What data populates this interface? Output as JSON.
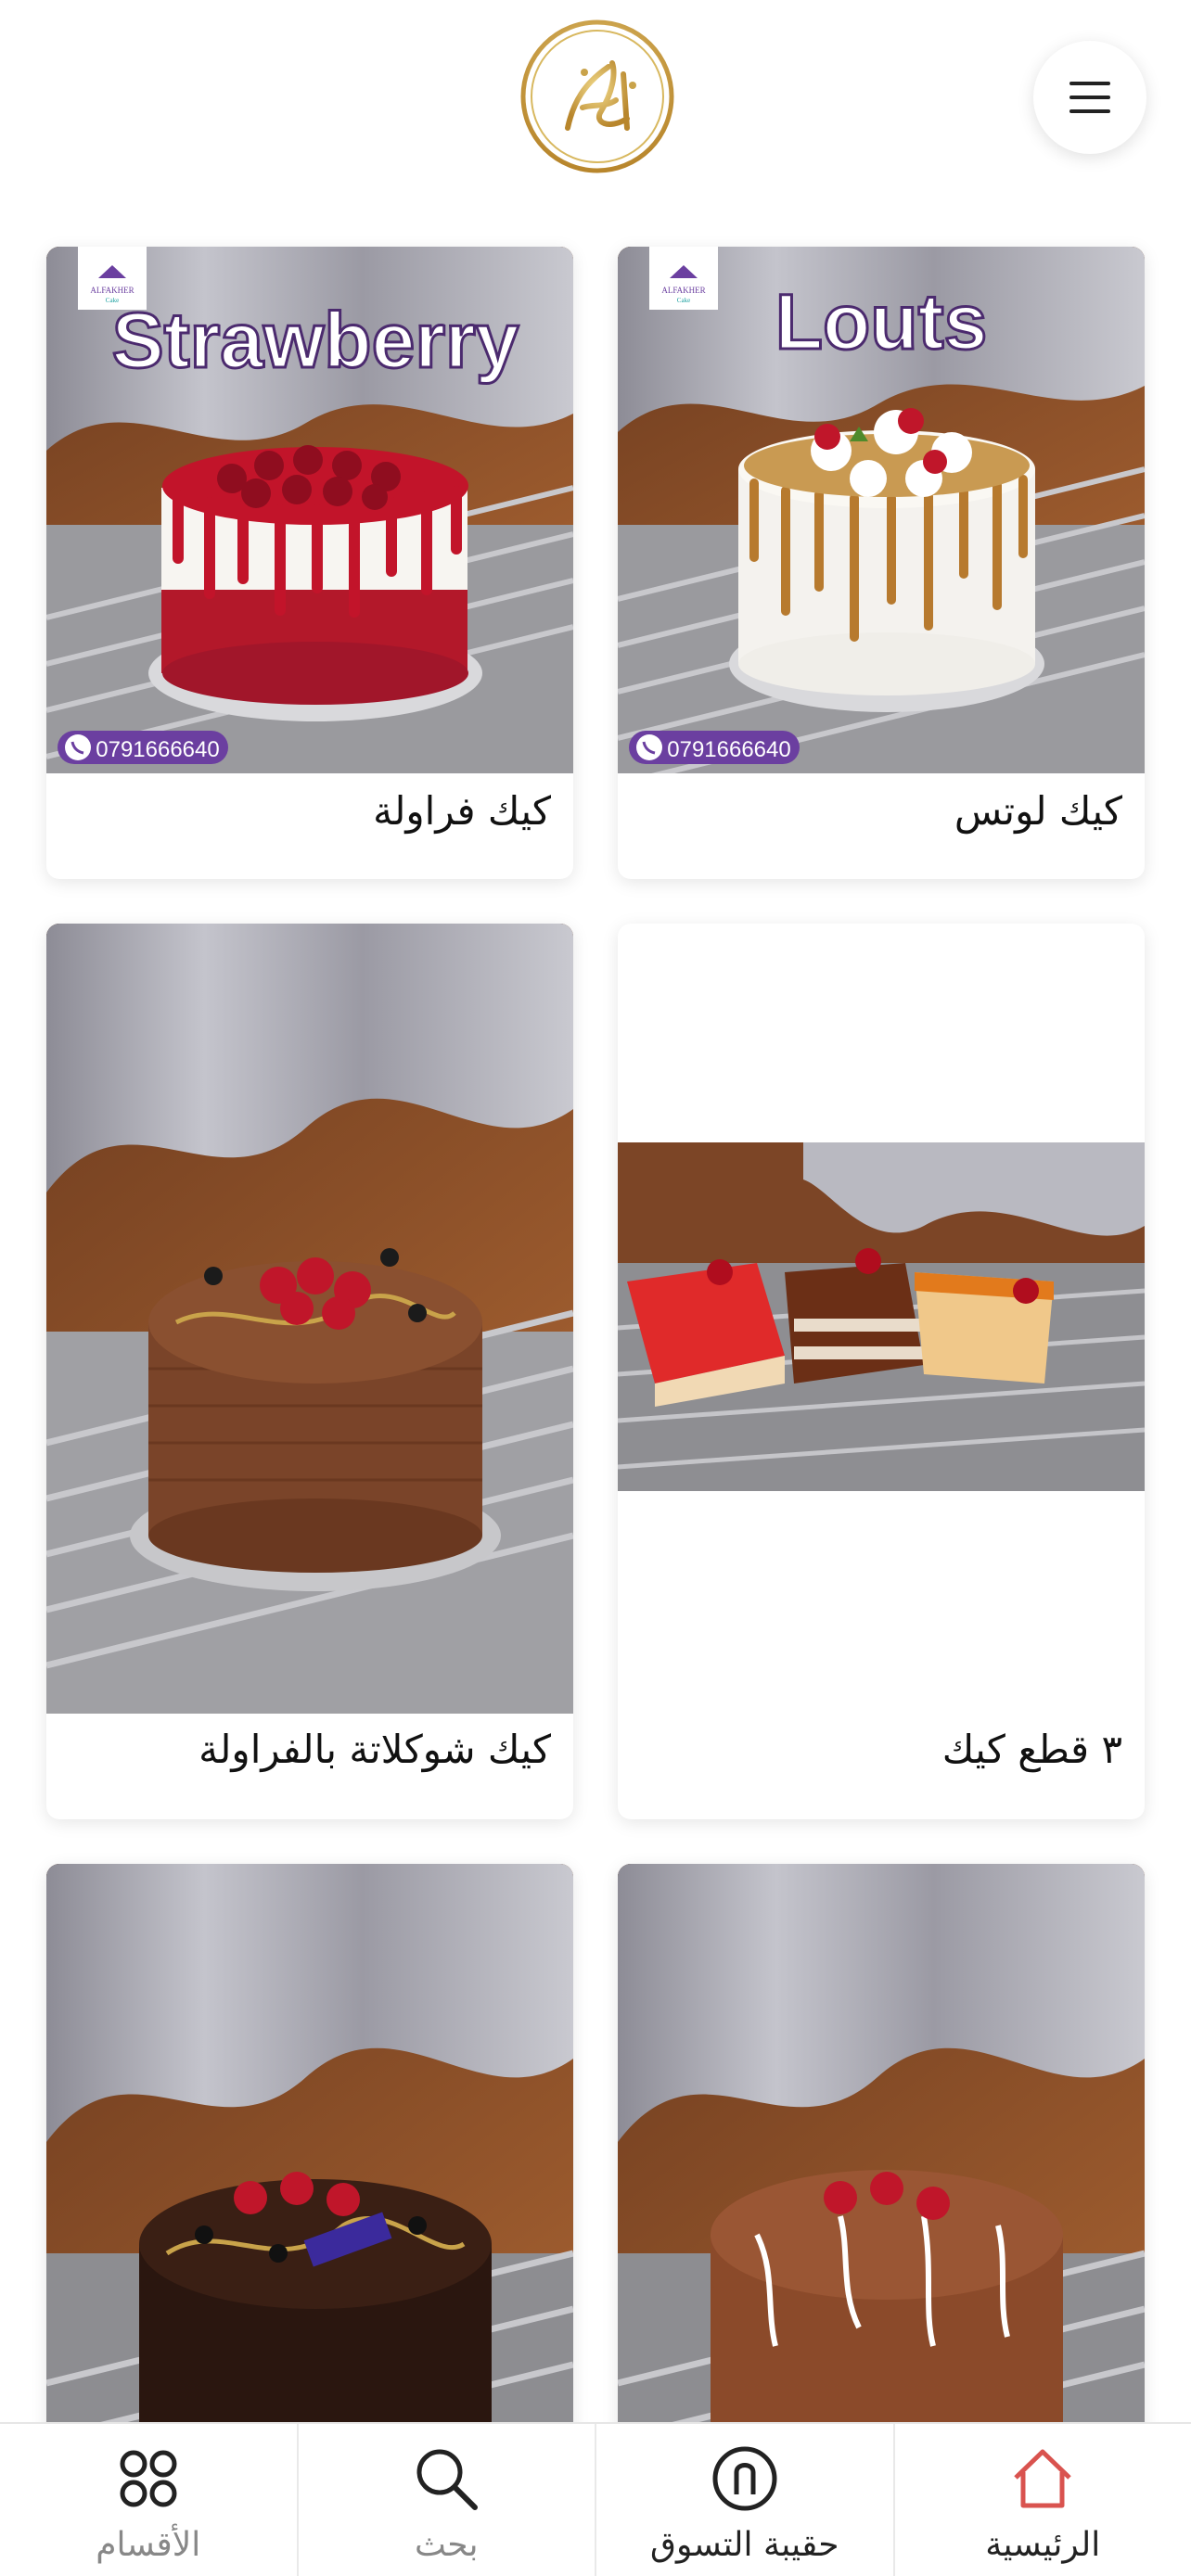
{
  "header": {
    "logo_icon": "alfakher-calligraphy-logo-icon",
    "menu_icon": "hamburger-menu-icon"
  },
  "products": [
    {
      "name": "كيك لوتس",
      "banner_text": "Louts",
      "phone": "0791666640",
      "brand": "ALFAKHER Cake"
    },
    {
      "name": "كيك فراولة",
      "banner_text": "Strawberry",
      "phone": "0791666640",
      "brand": "ALFAKHER Cake"
    },
    {
      "name": "٣ قطع كيك"
    },
    {
      "name": "كيك شوكلاتة بالفراولة"
    },
    {
      "name": ""
    },
    {
      "name": ""
    }
  ],
  "tabbar": {
    "items": [
      {
        "label": "الأقسام",
        "icon": "categories-grid-icon",
        "active": false
      },
      {
        "label": "بحث",
        "icon": "search-icon",
        "active": false
      },
      {
        "label": "حقيبة التسوق",
        "icon": "shopping-bag-icon",
        "active": false
      },
      {
        "label": "الرئيسية",
        "icon": "home-icon",
        "active": true
      }
    ]
  },
  "colors": {
    "accent": "#d9534f",
    "gold": "#c9a34a",
    "brand_purple": "#6b3fa0",
    "tab_inactive": "#888888",
    "tab_active_label": "#222222"
  }
}
